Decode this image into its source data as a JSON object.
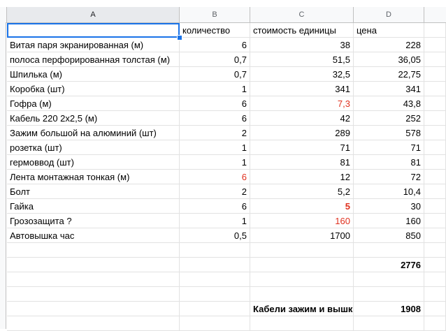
{
  "columns": [
    {
      "label": "A",
      "selected": true
    },
    {
      "label": "B",
      "selected": false
    },
    {
      "label": "C",
      "selected": false
    },
    {
      "label": "D",
      "selected": false
    }
  ],
  "rows": [
    {
      "a": "",
      "b": "количество",
      "c": "стоимость единицы",
      "d": "цена",
      "header": true
    },
    {
      "a": "Витая паря экранированная (м)",
      "b": "6",
      "c": "38",
      "d": "228"
    },
    {
      "a": "полоса перфорированная толстая (м)",
      "b": "0,7",
      "c": "51,5",
      "d": "36,05"
    },
    {
      "a": "Шпилька (м)",
      "b": "0,7",
      "c": "32,5",
      "d": "22,75"
    },
    {
      "a": "Коробка (шт)",
      "b": "1",
      "c": "341",
      "d": "341"
    },
    {
      "a": "Гофра (м)",
      "b": "6",
      "c": "7,3",
      "d": "43,8",
      "c_red": true
    },
    {
      "a": "Кабель 220 2х2,5 (м)",
      "b": "6",
      "c": "42",
      "d": "252"
    },
    {
      "a": "Зажим большой  на алюминий (шт)",
      "b": "2",
      "c": "289",
      "d": "578"
    },
    {
      "a": "розетка (шт)",
      "b": "1",
      "c": "71",
      "d": "71"
    },
    {
      "a": "гермоввод (шт)",
      "b": "1",
      "c": "81",
      "d": "81"
    },
    {
      "a": "Лента монтажная тонкая (м)",
      "b": "6",
      "c": "12",
      "d": "72",
      "b_red": true
    },
    {
      "a": "Болт",
      "b": "2",
      "c": "5,2",
      "d": "10,4"
    },
    {
      "a": "Гайка",
      "b": "6",
      "c": "5",
      "d": "30",
      "c_red": true,
      "c_bold": true
    },
    {
      "a": "Грозозащита ?",
      "b": "1",
      "c": "160",
      "d": "160",
      "c_red": true
    },
    {
      "a": "Автовышка час",
      "b": "0,5",
      "c": "1700",
      "d": "850"
    },
    {
      "a": "",
      "b": "",
      "c": "",
      "d": ""
    },
    {
      "a": "",
      "b": "",
      "c": "",
      "d": "2776",
      "d_bold": true
    },
    {
      "a": "",
      "b": "",
      "c": "",
      "d": ""
    },
    {
      "a": "",
      "b": "",
      "c": "",
      "d": ""
    },
    {
      "a": "",
      "b": "",
      "c": "Кабели зажим и вышка",
      "d": "1908",
      "c_bold": true,
      "d_bold": true
    },
    {
      "a": "",
      "b": "",
      "c": "",
      "d": ""
    }
  ],
  "colors": {
    "selection": "#1a73e8",
    "red_text": "#e0301e"
  }
}
